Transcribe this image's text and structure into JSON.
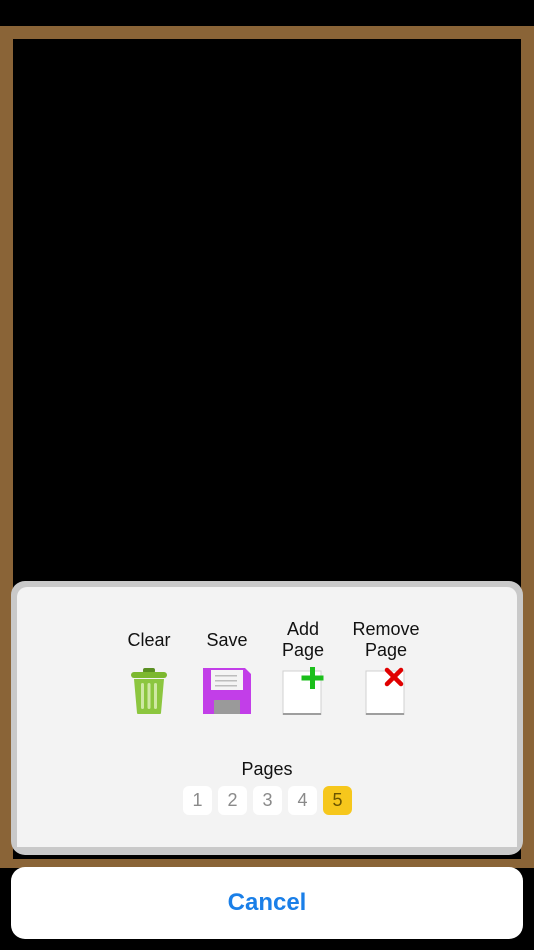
{
  "toolbar": {
    "clear_label": "Clear",
    "save_label": "Save",
    "add_page_label": "Add\nPage",
    "remove_page_label": "Remove\nPage"
  },
  "icons": {
    "clear": "trash-icon",
    "save": "floppy-disk-icon",
    "add_page": "add-page-icon",
    "remove_page": "remove-page-icon"
  },
  "pages": {
    "label": "Pages",
    "items": [
      "1",
      "2",
      "3",
      "4",
      "5"
    ],
    "selected": "5"
  },
  "colors": {
    "board_frame": "#8a6437",
    "board_surface": "#000000",
    "selected_page": "#f6c71c",
    "cancel_text": "#1a7fe8",
    "trash": "#8cc63f",
    "floppy": "#c23ee8"
  },
  "action_sheet": {
    "cancel_label": "Cancel"
  }
}
